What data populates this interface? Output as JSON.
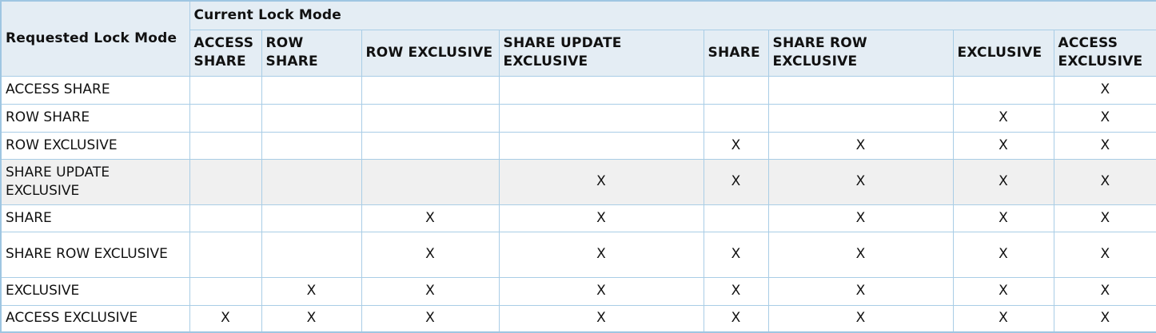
{
  "table": {
    "corner_label": "Requested Lock Mode",
    "group_label": "Current Lock Mode",
    "columns": [
      "ACCESS SHARE",
      "ROW SHARE",
      "ROW EXCLUSIVE",
      "SHARE UPDATE EXCLUSIVE",
      "SHARE",
      "SHARE ROW EXCLUSIVE",
      "EXCLUSIVE",
      "ACCESS EXCLUSIVE"
    ],
    "rows": [
      {
        "label": "ACCESS SHARE",
        "cells": [
          "",
          "",
          "",
          "",
          "",
          "",
          "",
          "X"
        ]
      },
      {
        "label": "ROW SHARE",
        "cells": [
          "",
          "",
          "",
          "",
          "",
          "",
          "X",
          "X"
        ]
      },
      {
        "label": "ROW EXCLUSIVE",
        "cells": [
          "",
          "",
          "",
          "",
          "X",
          "X",
          "X",
          "X"
        ]
      },
      {
        "label": "SHARE UPDATE EXCLUSIVE",
        "cells": [
          "",
          "",
          "",
          "X",
          "X",
          "X",
          "X",
          "X"
        ]
      },
      {
        "label": "SHARE",
        "cells": [
          "",
          "",
          "X",
          "X",
          "",
          "X",
          "X",
          "X"
        ]
      },
      {
        "label": "SHARE ROW EXCLUSIVE",
        "cells": [
          "",
          "",
          "X",
          "X",
          "X",
          "X",
          "X",
          "X"
        ]
      },
      {
        "label": "EXCLUSIVE",
        "cells": [
          "",
          "X",
          "X",
          "X",
          "X",
          "X",
          "X",
          "X"
        ]
      },
      {
        "label": "ACCESS EXCLUSIVE",
        "cells": [
          "X",
          "X",
          "X",
          "X",
          "X",
          "X",
          "X",
          "X"
        ]
      }
    ]
  }
}
